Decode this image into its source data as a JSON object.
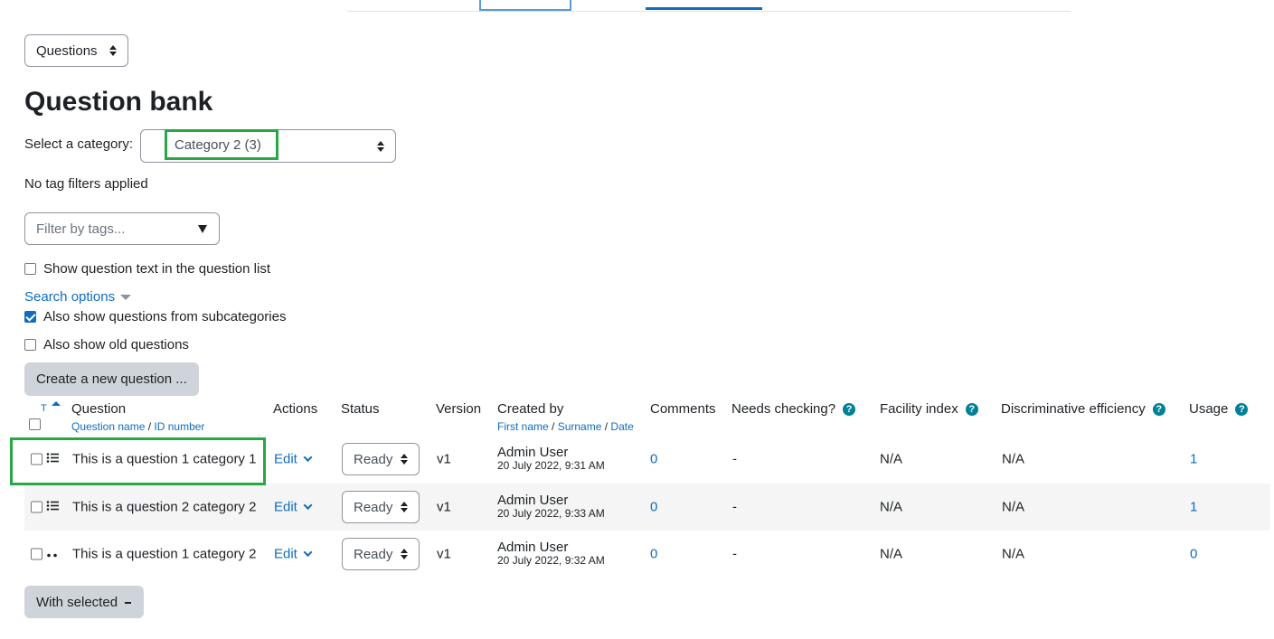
{
  "top_select": {
    "value": "Questions"
  },
  "page_title": "Question bank",
  "category": {
    "label": "Select a category:",
    "value": "Category 2 (3)"
  },
  "tag_status": "No tag filters applied",
  "tag_filter": {
    "placeholder": "Filter by tags..."
  },
  "options": {
    "show_text": {
      "label": "Show question text in the question list",
      "checked": false
    },
    "search_options": "Search options",
    "subcategories": {
      "label": "Also show questions from subcategories",
      "checked": true
    },
    "old_questions": {
      "label": "Also show old questions",
      "checked": false
    }
  },
  "create_button": "Create a new question ...",
  "table": {
    "sort_t": "T",
    "headers": {
      "question": "Question",
      "question_sub_name": "Question name",
      "question_sub_sep": " / ",
      "question_sub_id": "ID number",
      "actions": "Actions",
      "status": "Status",
      "version": "Version",
      "created_by": "Created by",
      "created_sub_first": "First name",
      "created_sub_sep1": " / ",
      "created_sub_surname": "Surname",
      "created_sub_sep2": " / ",
      "created_sub_date": "Date",
      "comments": "Comments",
      "needs_checking": "Needs checking?",
      "facility_index": "Facility index",
      "discriminative": "Discriminative efficiency",
      "usage": "Usage"
    },
    "rows": [
      {
        "name": "This is a question 1 category 1",
        "icon": "multichoice-icon",
        "edit": "Edit",
        "status": "Ready",
        "version": "v1",
        "created_name": "Admin User",
        "created_date": "20 July 2022, 9:31 AM",
        "comments": "0",
        "needs_checking": "-",
        "facility": "N/A",
        "discriminative": "N/A",
        "usage": "1"
      },
      {
        "name": "This is a question 2 category 2",
        "icon": "multichoice-icon",
        "edit": "Edit",
        "status": "Ready",
        "version": "v1",
        "created_name": "Admin User",
        "created_date": "20 July 2022, 9:33 AM",
        "comments": "0",
        "needs_checking": "-",
        "facility": "N/A",
        "discriminative": "N/A",
        "usage": "1"
      },
      {
        "name": "This is a question 1 category 2",
        "icon": "truefalse-icon",
        "edit": "Edit",
        "status": "Ready",
        "version": "v1",
        "created_name": "Admin User",
        "created_date": "20 July 2022, 9:32 AM",
        "comments": "0",
        "needs_checking": "-",
        "facility": "N/A",
        "discriminative": "N/A",
        "usage": "0"
      }
    ]
  },
  "with_selected": "With selected",
  "colors": {
    "link": "#0f6cbf",
    "highlight": "#28a745",
    "help": "#008196"
  }
}
